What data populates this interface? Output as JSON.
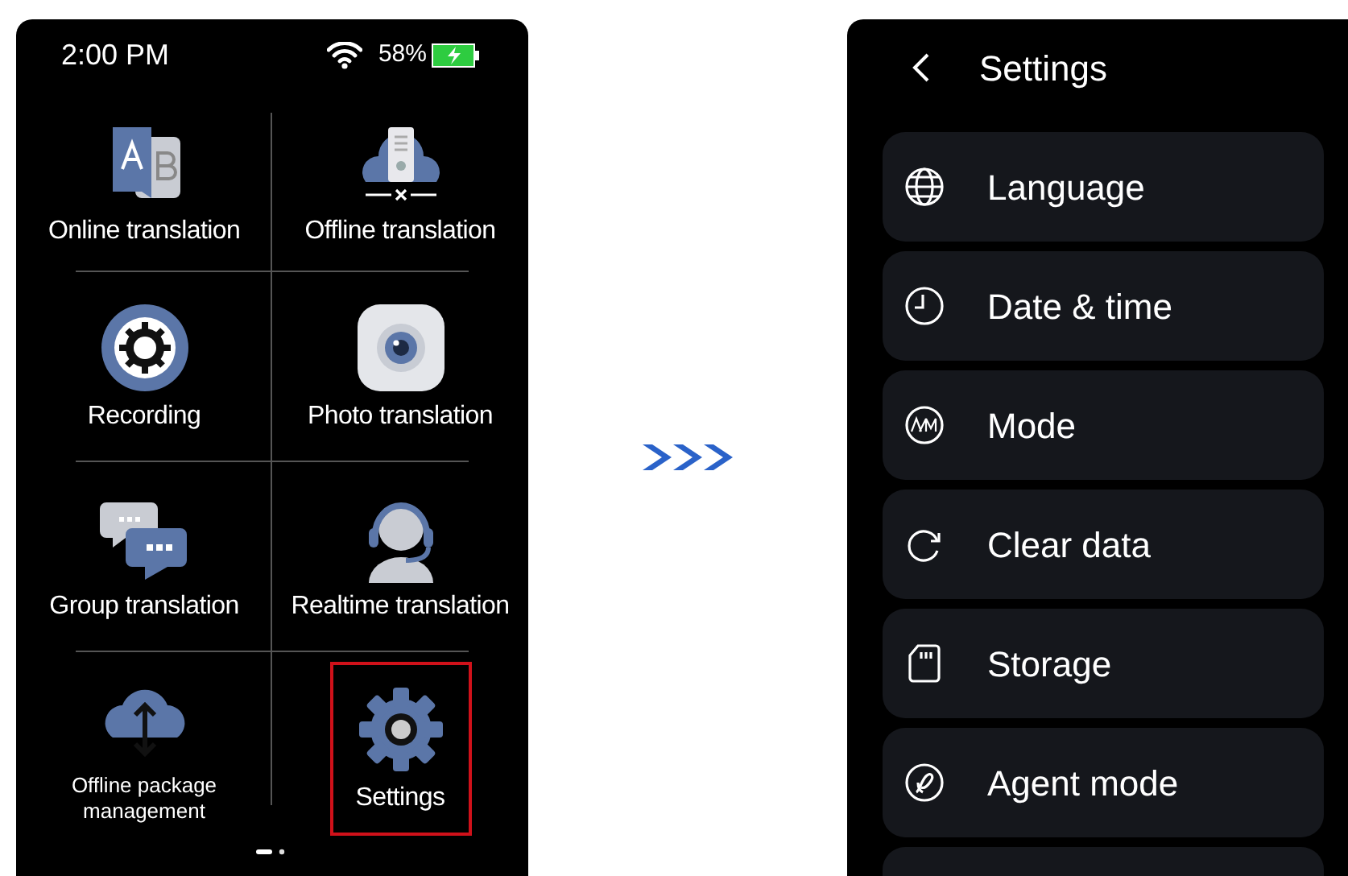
{
  "home_screen": {
    "status_bar": {
      "time": "2:00 PM",
      "battery": "58%"
    },
    "apps": [
      {
        "label": "Online translation",
        "selected": false
      },
      {
        "label": "Offline translation",
        "selected": false
      },
      {
        "label": "Recording",
        "selected": false
      },
      {
        "label": "Photo translation",
        "selected": false
      },
      {
        "label": "Group translation",
        "selected": false
      },
      {
        "label": "Realtime translation",
        "selected": false
      },
      {
        "label": "Offline package management",
        "selected": false
      },
      {
        "label": "Settings",
        "selected": true
      }
    ]
  },
  "settings_screen": {
    "title": "Settings",
    "items": [
      {
        "label": "Language"
      },
      {
        "label": "Date & time"
      },
      {
        "label": "Mode"
      },
      {
        "label": "Clear data"
      },
      {
        "label": "Storage"
      },
      {
        "label": "Agent mode"
      }
    ]
  }
}
